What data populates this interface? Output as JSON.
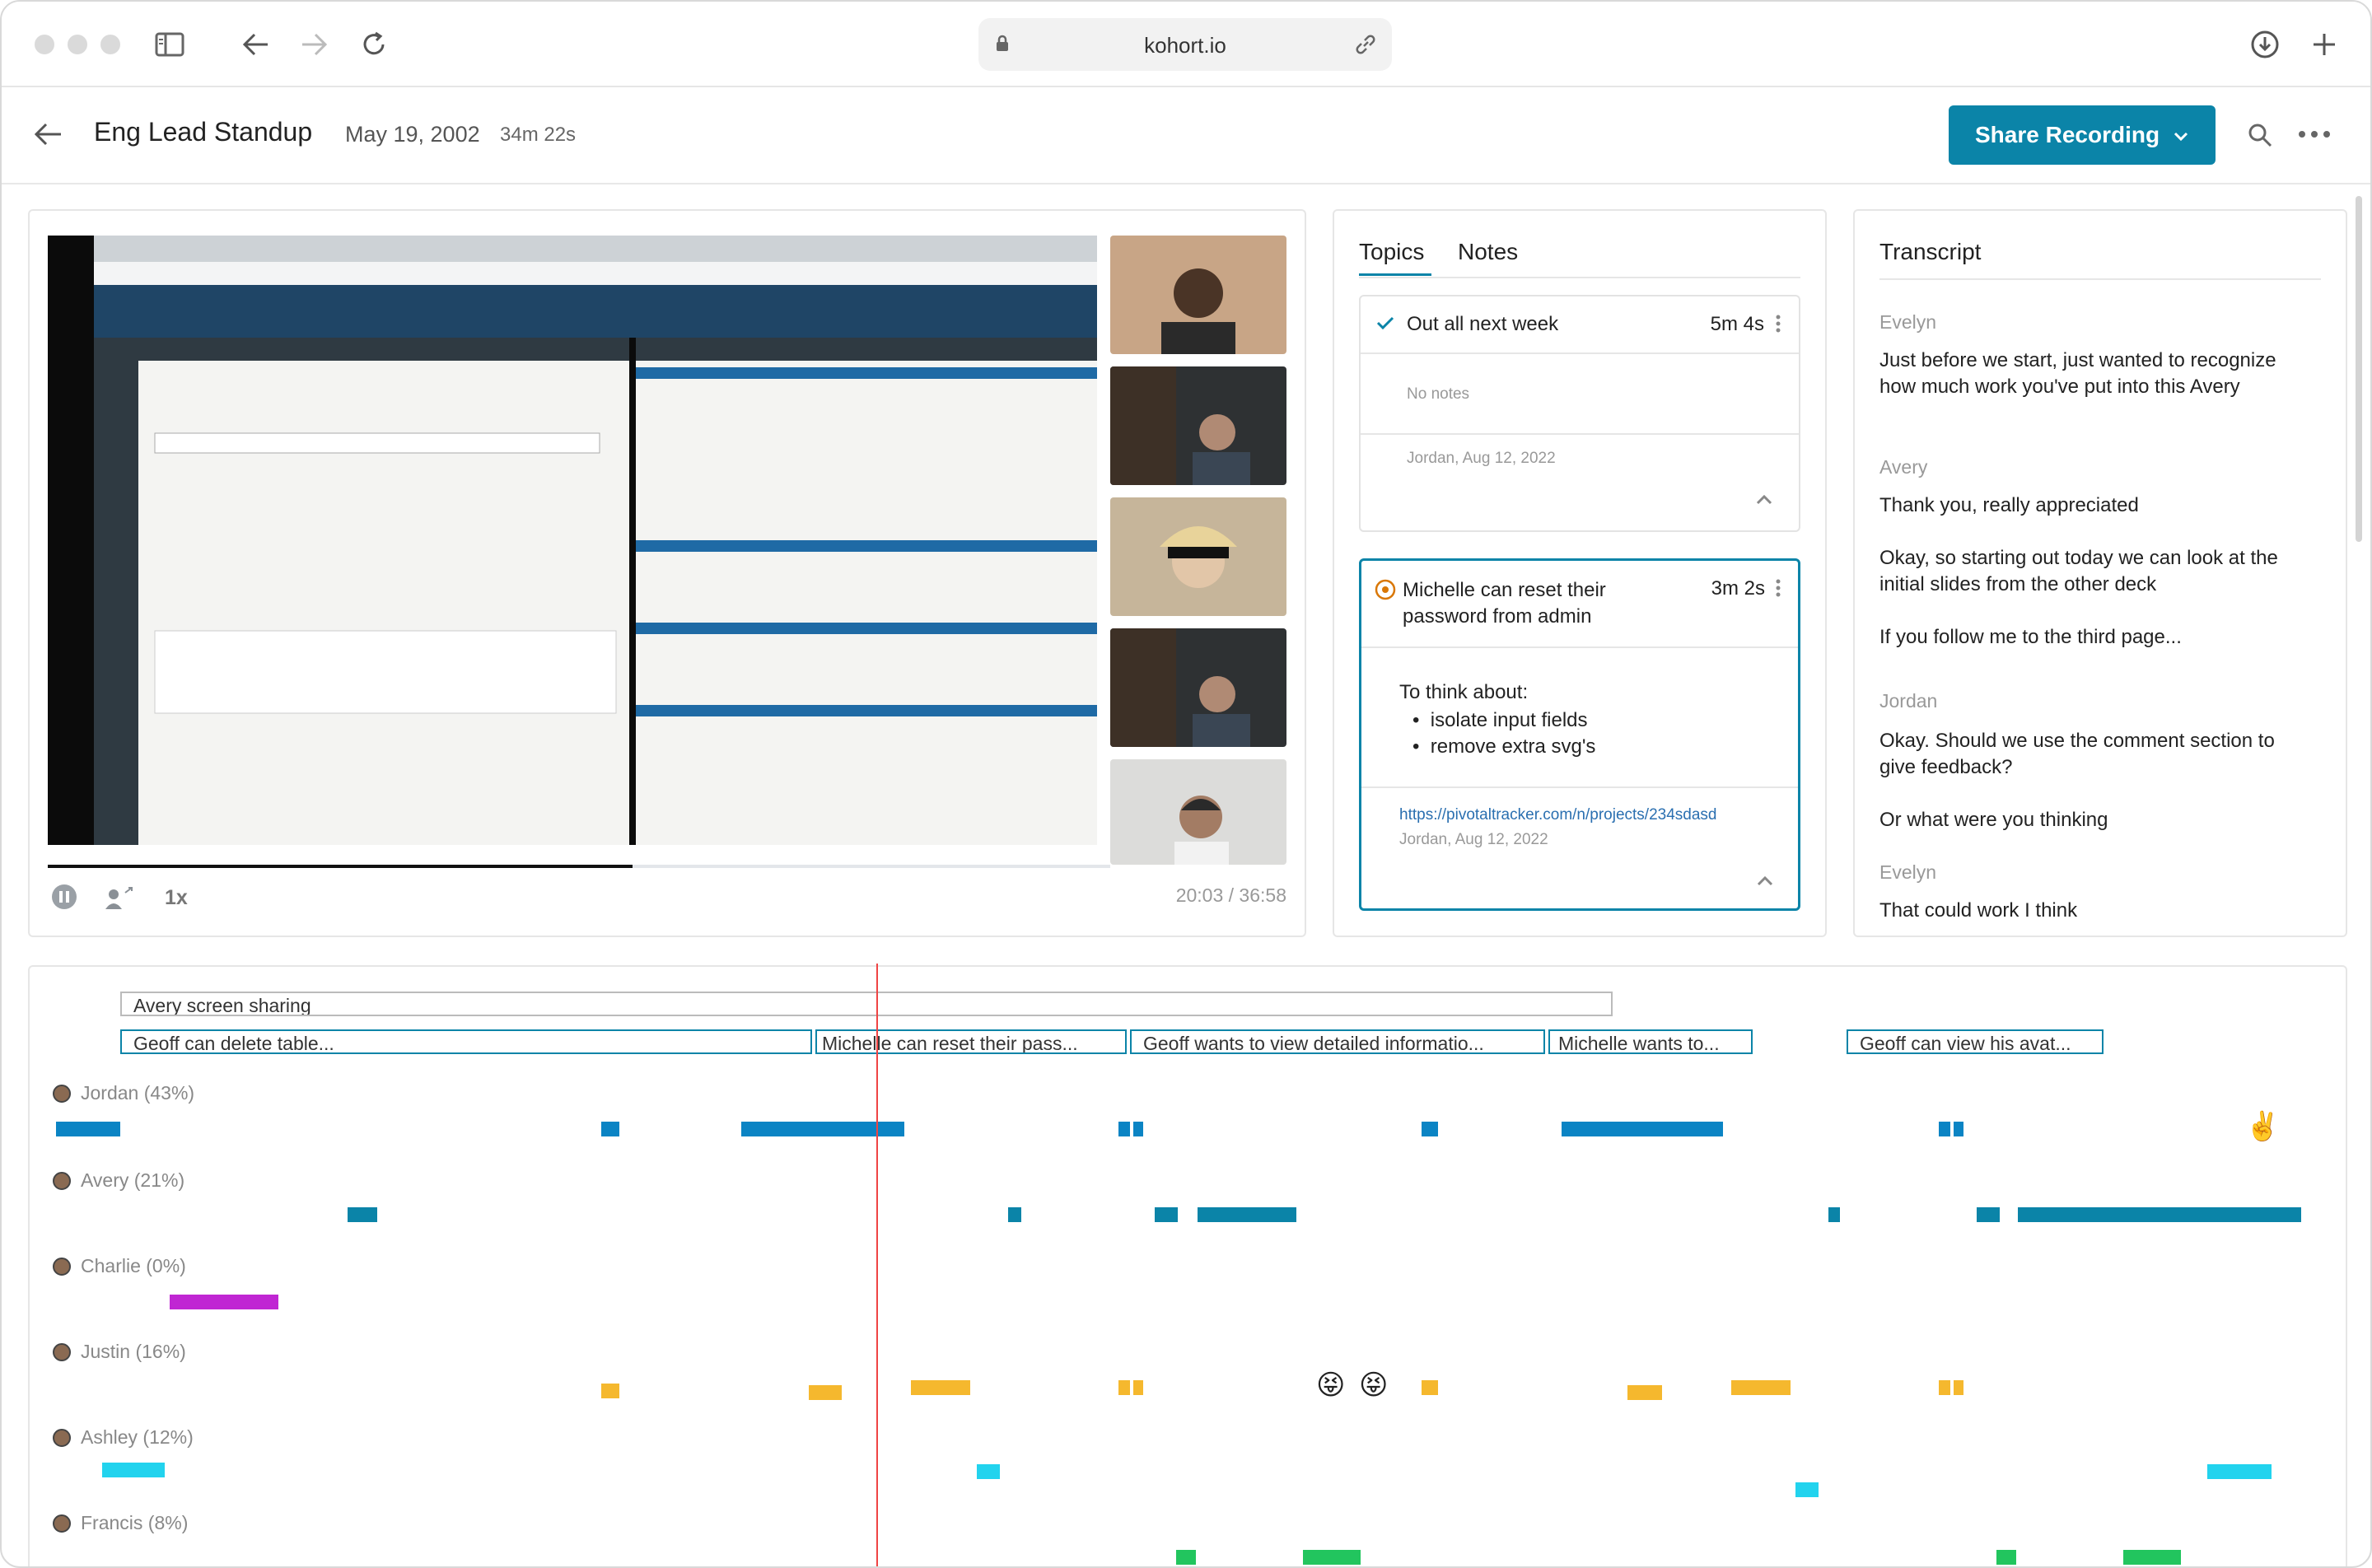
{
  "browser": {
    "url": "kohort.io"
  },
  "header": {
    "title": "Eng Lead Standup",
    "date": "May 19, 2002",
    "duration": "34m 22s",
    "share_label": "Share Recording"
  },
  "player": {
    "speed": "1x",
    "time": "20:03 / 36:58",
    "progress": 0.55
  },
  "topics": {
    "tabs": [
      "Topics",
      "Notes"
    ],
    "cards": [
      {
        "title": "Out all next week",
        "time": "5m 4s",
        "note": "No notes",
        "author": "Jordan, Aug 12, 2022"
      },
      {
        "title": "Michelle can reset their password from admin",
        "time": "3m 2s",
        "think": "To think about:",
        "bullets": [
          "isolate input fields",
          "remove extra svg's"
        ],
        "link": "https://pivotaltracker.com/n/projects/234sdasd",
        "author": "Jordan, Aug 12, 2022"
      }
    ]
  },
  "transcript": {
    "title": "Transcript",
    "entries": [
      {
        "speaker": "Evelyn",
        "lines": [
          "Just before we start, just wanted to recognize how much work you've put into this Avery"
        ]
      },
      {
        "speaker": "Avery",
        "lines": [
          "Thank you, really appreciated",
          "Okay, so starting out today we can look at the initial slides from the other deck",
          "If you follow me to the third page..."
        ]
      },
      {
        "speaker": "Jordan",
        "lines": [
          "Okay. Should we use the comment section to give feedback?",
          "Or what were you thinking"
        ]
      },
      {
        "speaker": "Evelyn",
        "lines": [
          "That could work I think"
        ]
      }
    ]
  },
  "timeline": {
    "screen_share": "Avery screen sharing",
    "topics": [
      "Geoff can delete table...",
      "Michelle can reset their pass...",
      "Geoff wants to view detailed informatio...",
      "Michelle wants to...",
      "Geoff can view his avat..."
    ],
    "participants": [
      {
        "label": "Jordan (43%)",
        "color": "#0b84c4"
      },
      {
        "label": "Avery (21%)",
        "color": "#0b84a8"
      },
      {
        "label": "Charlie (0%)",
        "color": "#c026d3"
      },
      {
        "label": "Justin (16%)",
        "color": "#f5b82e"
      },
      {
        "label": "Ashley (12%)",
        "color": "#22d3ee"
      },
      {
        "label": "Francis (8%)",
        "color": "#22c55e"
      }
    ],
    "emojis": [
      "✌️",
      "😝",
      "😝"
    ]
  }
}
